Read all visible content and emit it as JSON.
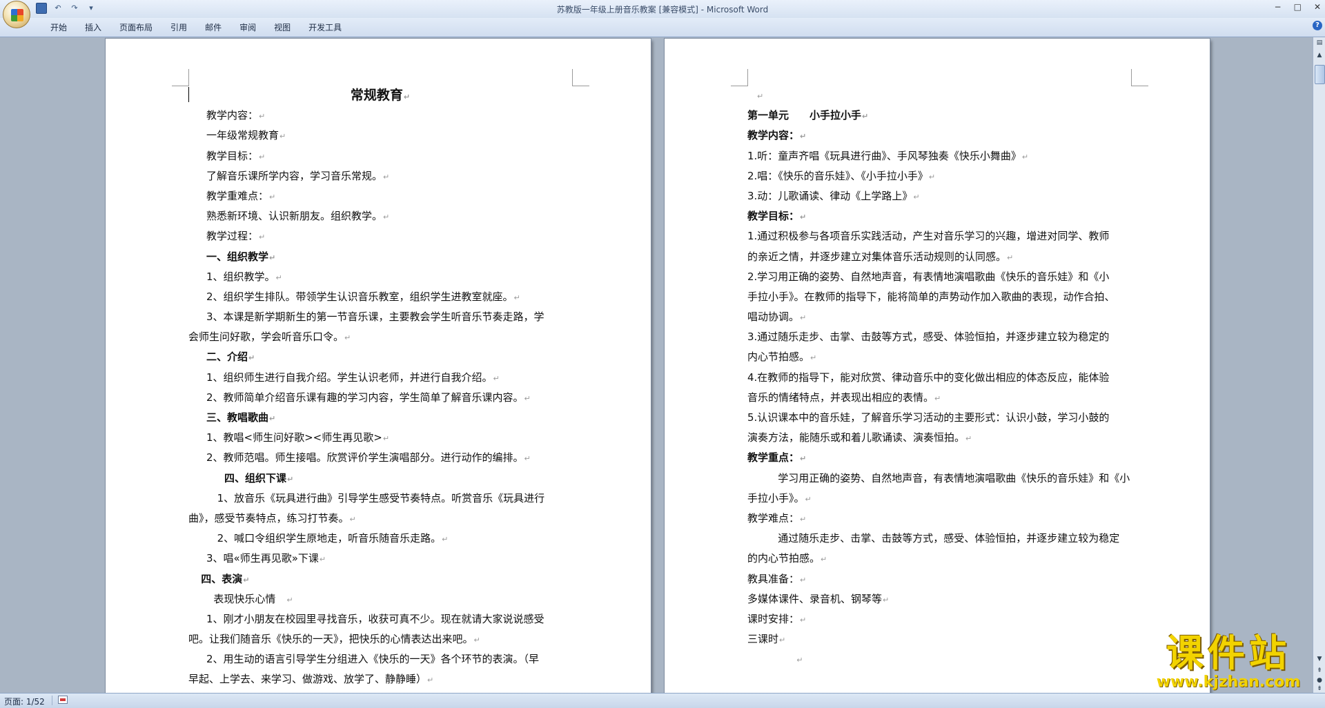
{
  "window": {
    "title": "苏教版一年级上册音乐教案 [兼容模式] - Microsoft Word",
    "minimize": "−",
    "maximize": "□",
    "close": "✕"
  },
  "ribbon": {
    "tabs": [
      "开始",
      "插入",
      "页面布局",
      "引用",
      "邮件",
      "审阅",
      "视图",
      "开发工具"
    ],
    "help": "?"
  },
  "left_page": {
    "title": "常规教育",
    "lines": [
      {
        "text": "教学内容：",
        "indent": 1
      },
      {
        "text": "一年级常规教育",
        "indent": 1
      },
      {
        "text": "教学目标：",
        "indent": 1
      },
      {
        "text": "了解音乐课所学内容，学习音乐常规。",
        "indent": 1
      },
      {
        "text": "教学重难点：",
        "indent": 1
      },
      {
        "text": "熟悉新环境、认识新朋友。组织教学。",
        "indent": 1
      },
      {
        "text": "教学过程：",
        "indent": 1
      },
      {
        "text": "一、组织教学",
        "indent": 1,
        "bold": true
      },
      {
        "text": "1、组织教学。",
        "indent": 1
      },
      {
        "text": "2、组织学生排队。带领学生认识音乐教室，组织学生进教室就座。",
        "indent": 1
      },
      {
        "text": "3、本课是新学期新生的第一节音乐课，主要教会学生听音乐节奏走路，学",
        "indent": 1,
        "nomark": true
      },
      {
        "text": "会师生问好歌，学会听音乐口令。",
        "indent": 0
      },
      {
        "text": "二、介绍",
        "indent": 1,
        "bold": true
      },
      {
        "text": "1、组织师生进行自我介绍。学生认识老师，并进行自我介绍。",
        "indent": 1
      },
      {
        "text": "2、教师简单介绍音乐课有趣的学习内容，学生简单了解音乐课内容。",
        "indent": 1
      },
      {
        "text": "三、教唱歌曲",
        "indent": 1,
        "bold": true
      },
      {
        "text": "1、教唱<师生问好歌><师生再见歌>",
        "indent": 1
      },
      {
        "text": "2、教师范唱。师生接唱。欣赏评价学生演唱部分。进行动作的编排。",
        "indent": 1
      },
      {
        "text": "四、组织下课",
        "indent": 2,
        "bold": true
      },
      {
        "text": "1、放音乐《玩具进行曲》引导学生感受节奏特点。听赏音乐《玩具进行",
        "indent": 1.6,
        "nomark": true
      },
      {
        "text": "曲》，感受节奏特点，练习打节奏。",
        "indent": 0
      },
      {
        "text": "2、喊口令组织学生原地走，听音乐随音乐走路。",
        "indent": 1.6
      },
      {
        "text": "3、唱«师生再见歌»下课",
        "indent": 1
      },
      {
        "text": "四、表演",
        "indent": 0.7,
        "bold": true
      },
      {
        "text": "表现快乐心情　",
        "indent": 1.4
      },
      {
        "text": "1、刚才小朋友在校园里寻找音乐，收获可真不少。现在就请大家说说感受",
        "indent": 1,
        "nomark": true
      },
      {
        "text": "吧。让我们随音乐《快乐的一天》，把快乐的心情表达出来吧。",
        "indent": 0
      },
      {
        "text": "2、用生动的语言引导学生分组进入《快乐的一天》各个环节的表演。（早",
        "indent": 1,
        "nomark": true
      },
      {
        "text": "早起、上学去、来学习、做游戏、放学了、静静睡）",
        "indent": 0
      }
    ]
  },
  "right_page": {
    "lines": [
      {
        "text": "",
        "indent": 0.5
      },
      {
        "text": "第一单元　　小手拉小手",
        "indent": 0,
        "bold": true
      },
      {
        "text": "教学内容：",
        "indent": 0,
        "bold": true
      },
      {
        "text": "1.听：童声齐唱《玩具进行曲》、手风琴独奏《快乐小舞曲》",
        "indent": 0
      },
      {
        "text": "2.唱：《快乐的音乐娃》、《小手拉小手》",
        "indent": 0
      },
      {
        "text": "3.动：儿歌诵读、律动《上学路上》",
        "indent": 0
      },
      {
        "text": "教学目标：",
        "indent": 0,
        "bold": true
      },
      {
        "text": "1.通过积极参与各项音乐实践活动，产生对音乐学习的兴趣，增进对同学、教师",
        "indent": 0,
        "nomark": true
      },
      {
        "text": "的亲近之情，并逐步建立对集体音乐活动规则的认同感。",
        "indent": 0
      },
      {
        "text": "2.学习用正确的姿势、自然地声音，有表情地演唱歌曲《快乐的音乐娃》和《小",
        "indent": 0,
        "nomark": true
      },
      {
        "text": "手拉小手》。在教师的指导下，能将简单的声势动作加入歌曲的表现，动作合拍、",
        "indent": 0,
        "nomark": true
      },
      {
        "text": "唱动协调。",
        "indent": 0
      },
      {
        "text": "3.通过随乐走步、击掌、击鼓等方式，感受、体验恒拍，并逐步建立较为稳定的",
        "indent": 0,
        "nomark": true
      },
      {
        "text": "内心节拍感。",
        "indent": 0
      },
      {
        "text": "4.在教师的指导下，能对欣赏、律动音乐中的变化做出相应的体态反应，能体验",
        "indent": 0,
        "nomark": true
      },
      {
        "text": "音乐的情绪特点，并表现出相应的表情。",
        "indent": 0
      },
      {
        "text": "5.认识课本中的音乐娃，了解音乐学习活动的主要形式：认识小鼓，学习小鼓的",
        "indent": 0,
        "nomark": true
      },
      {
        "text": "演奏方法，能随乐或和着儿歌诵读、演奏恒拍。",
        "indent": 0
      },
      {
        "text": "教学重点：",
        "indent": 0,
        "bold": true
      },
      {
        "text": "学习用正确的姿势、自然地声音，有表情地演唱歌曲《快乐的音乐娃》和《小",
        "indent": 1.7,
        "nomark": true
      },
      {
        "text": "手拉小手》。",
        "indent": 0
      },
      {
        "text": "教学难点：",
        "indent": 0
      },
      {
        "text": "通过随乐走步、击掌、击鼓等方式，感受、体验恒拍，并逐步建立较为稳定",
        "indent": 1.7,
        "nomark": true
      },
      {
        "text": "的内心节拍感。",
        "indent": 0
      },
      {
        "text": "教具准备：",
        "indent": 0
      },
      {
        "text": "多媒体课件、录音机、钢琴等",
        "indent": 0
      },
      {
        "text": "课时安排：",
        "indent": 0
      },
      {
        "text": "三课时",
        "indent": 0
      },
      {
        "text": "",
        "indent": 2.7
      }
    ]
  },
  "paragraph_mark": "↵",
  "status": {
    "page": "页面: 1/52"
  },
  "watermark": {
    "main": "课件站",
    "url": "www.kjzhan.com"
  },
  "icons": {
    "office_button": "office-logo",
    "save": "save-icon",
    "undo": "undo-icon",
    "redo": "redo-icon"
  }
}
